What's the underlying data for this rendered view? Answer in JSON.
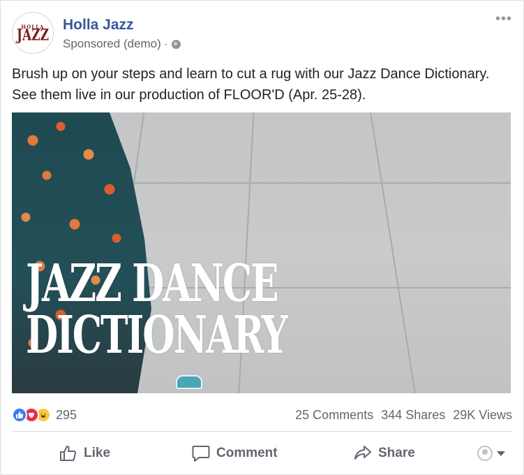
{
  "post": {
    "page_name": "Holla Jazz",
    "avatar_line1": "HOLLA",
    "avatar_line2": "JAZZ",
    "sponsored": "Sponsored (demo)",
    "separator": "·",
    "more": "•••",
    "message_line1": "Brush up on your steps and learn to cut a rug with our Jazz Dance Dictionary.",
    "message_line2": "See them live in our production of FLOOR'D (Apr. 25-28).",
    "media_title_line1": "JAZZ DANCE",
    "media_title_line2": "DICTIONARY"
  },
  "stats": {
    "reaction_icons": [
      "like-icon",
      "love-icon",
      "haha-icon"
    ],
    "reactions_count": "295",
    "comments": "25 Comments",
    "shares": "344 Shares",
    "views": "29K Views"
  },
  "actions": {
    "like": "Like",
    "comment": "Comment",
    "share": "Share"
  },
  "colors": {
    "page_name": "#365899",
    "meta": "#606770",
    "like_reaction": "#3b7bf6",
    "love_reaction": "#f0284a",
    "haha_reaction": "#f7c844"
  }
}
